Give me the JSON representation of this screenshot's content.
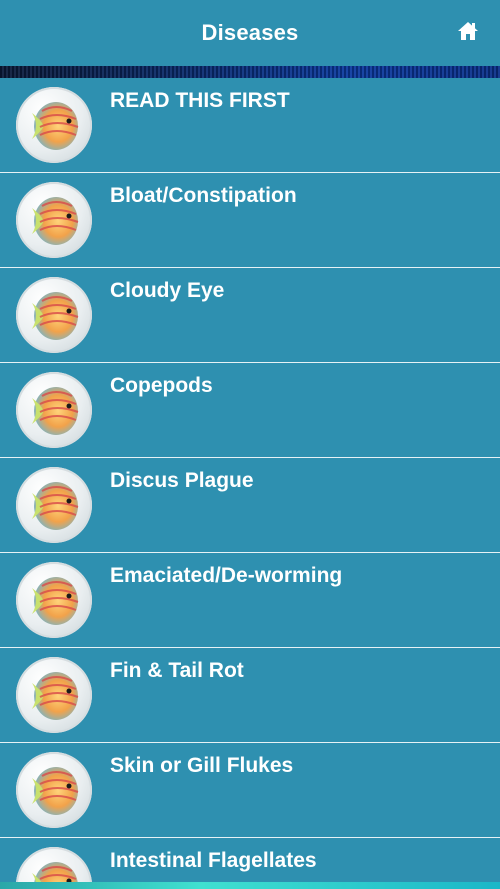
{
  "header": {
    "title": "Diseases",
    "home_icon": "home-icon"
  },
  "list": {
    "items": [
      {
        "label": "READ THIS FIRST"
      },
      {
        "label": "Bloat/Constipation"
      },
      {
        "label": "Cloudy Eye"
      },
      {
        "label": "Copepods"
      },
      {
        "label": "Discus Plague"
      },
      {
        "label": "Emaciated/De-worming"
      },
      {
        "label": "Fin & Tail Rot"
      },
      {
        "label": "Skin or Gill Flukes"
      },
      {
        "label": "Intestinal Flagellates"
      }
    ],
    "thumbnail_icon": "discus-fish-icon"
  },
  "colors": {
    "background": "#2e90b0",
    "text": "#ffffff",
    "separator": "#e6f2f6"
  }
}
